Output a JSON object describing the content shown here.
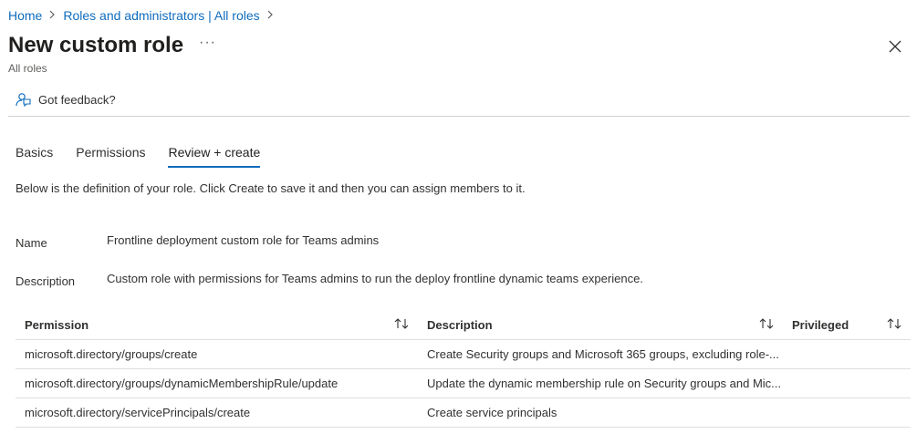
{
  "breadcrumb": {
    "home": "Home",
    "roles": "Roles and administrators | All roles"
  },
  "header": {
    "title": "New custom role",
    "more": "···",
    "subtitle": "All roles"
  },
  "toolbar": {
    "feedback_label": "Got feedback?"
  },
  "tabs": [
    {
      "label": "Basics",
      "active": false
    },
    {
      "label": "Permissions",
      "active": false
    },
    {
      "label": "Review + create",
      "active": true
    }
  ],
  "intro": "Below is the definition of your role. Click Create to save it and then you can assign members to it.",
  "fields": {
    "name_label": "Name",
    "name_value": "Frontline deployment custom role for Teams admins",
    "description_label": "Description",
    "description_value": "Custom role with permissions for Teams admins to run the deploy frontline dynamic teams experience."
  },
  "table": {
    "columns": [
      "Permission",
      "Description",
      "Privileged"
    ],
    "rows": [
      {
        "permission": "microsoft.directory/groups/create",
        "description": "Create Security groups and Microsoft 365 groups, excluding role-...",
        "privileged": ""
      },
      {
        "permission": "microsoft.directory/groups/dynamicMembershipRule/update",
        "description": "Update the dynamic membership rule on Security groups and Mic...",
        "privileged": ""
      },
      {
        "permission": "microsoft.directory/servicePrincipals/create",
        "description": "Create service principals",
        "privileged": ""
      }
    ]
  },
  "colors": {
    "link": "#0f6cbd",
    "text": "#323130",
    "divider": "#d2d0ce"
  }
}
